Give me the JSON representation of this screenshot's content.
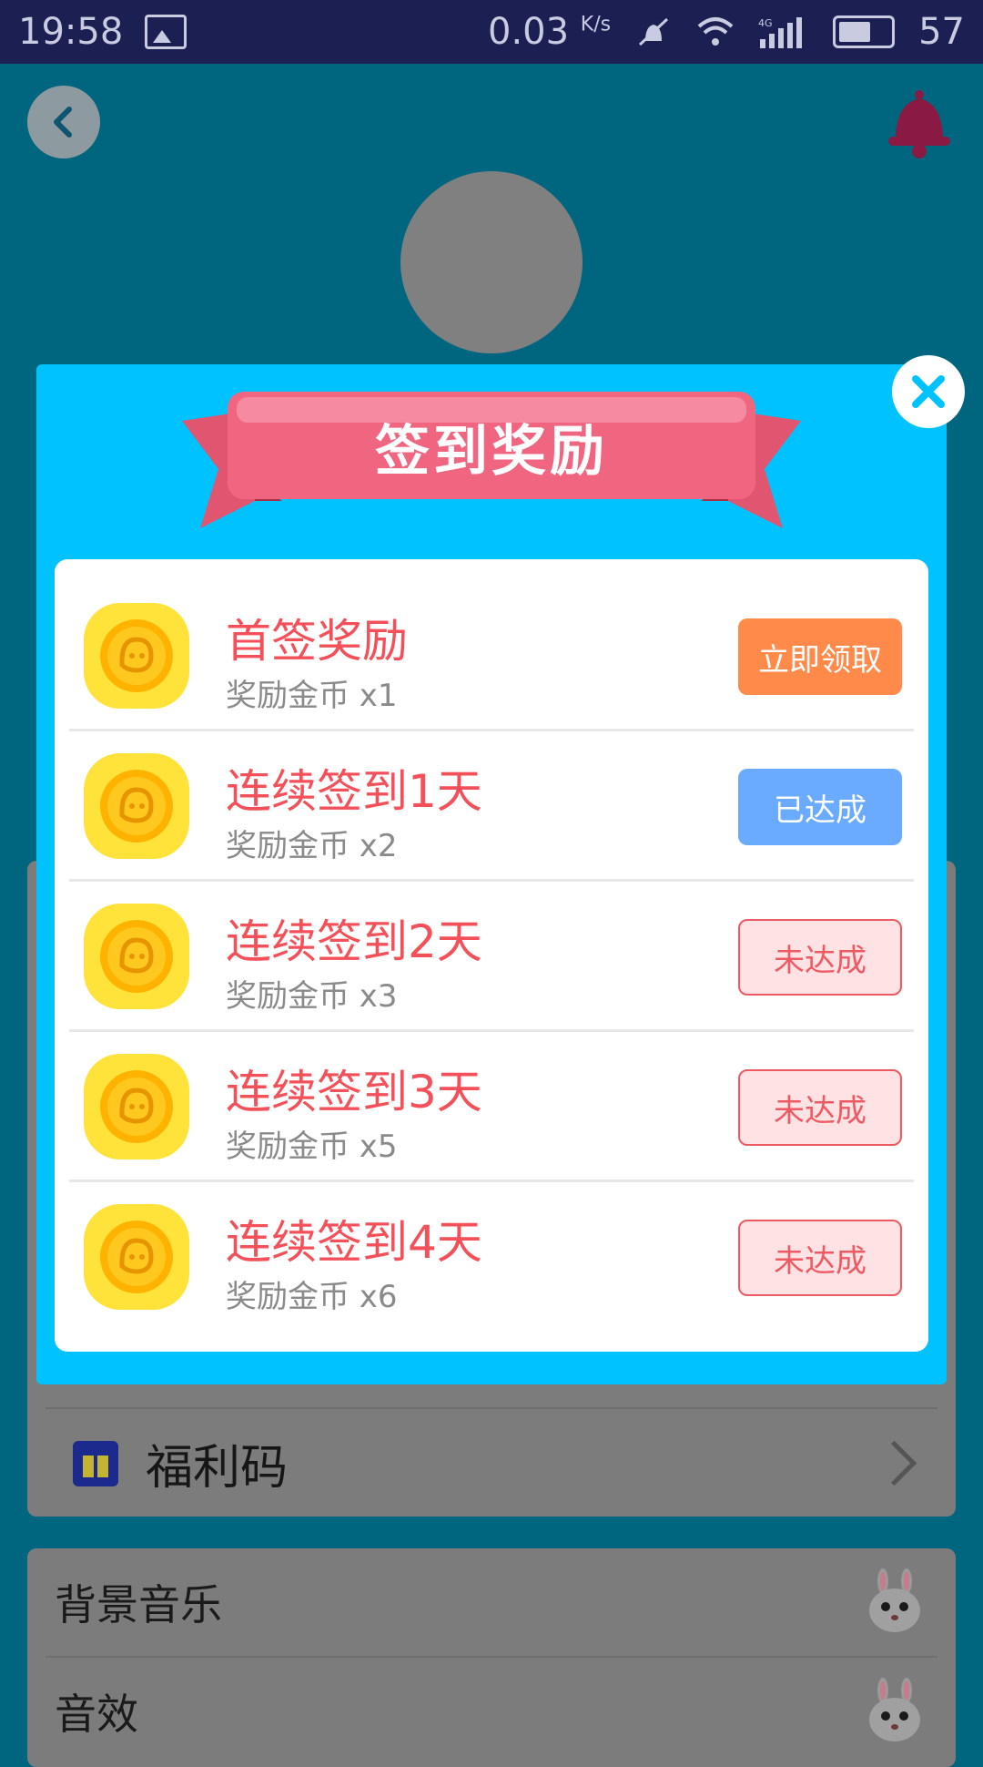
{
  "status_bar": {
    "time": "19:58",
    "net_speed": "0.03",
    "net_speed_unit": "K/s",
    "signal_label": "4G",
    "battery": "57"
  },
  "background": {
    "welfare_code_label": "福利码",
    "settings": [
      {
        "label": "背景音乐"
      },
      {
        "label": "音效"
      }
    ]
  },
  "modal": {
    "title": "签到奖励",
    "rewards": [
      {
        "title": "首签奖励",
        "subtitle": "奖励金币 x1",
        "button": "立即领取",
        "state": "claim"
      },
      {
        "title": "连续签到1天",
        "subtitle": "奖励金币 x2",
        "button": "已达成",
        "state": "done"
      },
      {
        "title": "连续签到2天",
        "subtitle": "奖励金币 x3",
        "button": "未达成",
        "state": "pending"
      },
      {
        "title": "连续签到3天",
        "subtitle": "奖励金币 x5",
        "button": "未达成",
        "state": "pending"
      },
      {
        "title": "连续签到4天",
        "subtitle": "奖励金币 x6",
        "button": "未达成",
        "state": "pending"
      }
    ]
  },
  "colors": {
    "modal_bg": "#00c2ff",
    "title_red": "#f4505a",
    "claim_orange": "#ff8a4a",
    "done_blue": "#6aabff",
    "ribbon_pink": "#f06680"
  },
  "icons": [
    "back-arrow-icon",
    "bell-icon",
    "close-icon",
    "coin-icon",
    "gift-icon",
    "chevron-right-icon",
    "bunny-icon"
  ]
}
